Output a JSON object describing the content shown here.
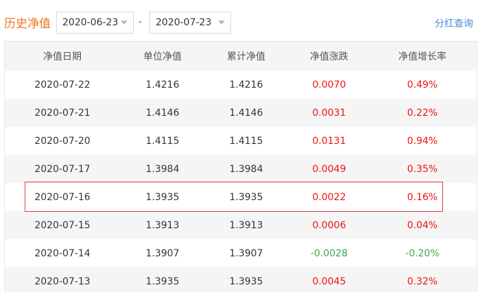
{
  "header": {
    "title": "历史净值",
    "start_date": "2020-06-23",
    "end_date": "2020-07-23",
    "separator": "-",
    "dividend_link": "分红查询"
  },
  "table": {
    "columns": [
      "净值日期",
      "单位净值",
      "累计净值",
      "净值涨跌",
      "净值增长率"
    ],
    "rows": [
      {
        "date": "2020-07-22",
        "unit": "1.4216",
        "cumulative": "1.4216",
        "change": "0.0070",
        "rate": "0.49%",
        "direction": "up"
      },
      {
        "date": "2020-07-21",
        "unit": "1.4146",
        "cumulative": "1.4146",
        "change": "0.0031",
        "rate": "0.22%",
        "direction": "up"
      },
      {
        "date": "2020-07-20",
        "unit": "1.4115",
        "cumulative": "1.4115",
        "change": "0.0131",
        "rate": "0.94%",
        "direction": "up"
      },
      {
        "date": "2020-07-17",
        "unit": "1.3984",
        "cumulative": "1.3984",
        "change": "0.0049",
        "rate": "0.35%",
        "direction": "up"
      },
      {
        "date": "2020-07-16",
        "unit": "1.3935",
        "cumulative": "1.3935",
        "change": "0.0022",
        "rate": "0.16%",
        "direction": "up"
      },
      {
        "date": "2020-07-15",
        "unit": "1.3913",
        "cumulative": "1.3913",
        "change": "0.0006",
        "rate": "0.04%",
        "direction": "up"
      },
      {
        "date": "2020-07-14",
        "unit": "1.3907",
        "cumulative": "1.3907",
        "change": "-0.0028",
        "rate": "-0.20%",
        "direction": "down"
      },
      {
        "date": "2020-07-13",
        "unit": "1.3935",
        "cumulative": "1.3935",
        "change": "0.0045",
        "rate": "0.32%",
        "direction": "up"
      }
    ],
    "highlighted_row_date": "2020-07-16"
  },
  "colors": {
    "title": "#f2711c",
    "link": "#3d8fd8",
    "positive": "#ee1111",
    "negative": "#3aa64a",
    "highlight_border": "#e2393d"
  }
}
